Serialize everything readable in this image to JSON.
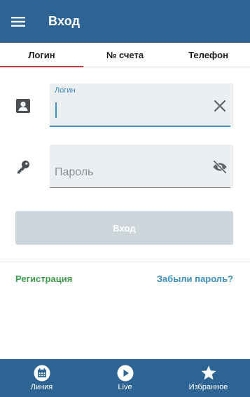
{
  "appbar": {
    "title": "Вход",
    "menu_icon": "hamburger-menu-icon"
  },
  "tabs": [
    {
      "label": "Логин",
      "active": true
    },
    {
      "label": "№ счета",
      "active": false
    },
    {
      "label": "Телефон",
      "active": false
    }
  ],
  "login_field": {
    "float_label": "Логин",
    "value": "",
    "icon": "contact-card-icon",
    "action_icon": "clear-x-icon"
  },
  "password_field": {
    "placeholder": "Пароль",
    "value": "",
    "icon": "key-icon",
    "action_icon": "eye-off-icon"
  },
  "submit": {
    "label": "Вход",
    "enabled": false
  },
  "links": {
    "register": "Регистрация",
    "forgot": "Забыли пароль?"
  },
  "bottom_nav": [
    {
      "label": "Линия",
      "icon": "calendar-icon"
    },
    {
      "label": "Live",
      "icon": "play-icon"
    },
    {
      "label": "Избранное",
      "icon": "star-icon"
    }
  ],
  "colors": {
    "primary": "#2e6494",
    "accent_red": "#d0343a",
    "field_focus": "#3c8dbd",
    "link_green": "#3e9a4c",
    "link_blue": "#3a8fbd",
    "button_disabled": "#cdd6da"
  }
}
